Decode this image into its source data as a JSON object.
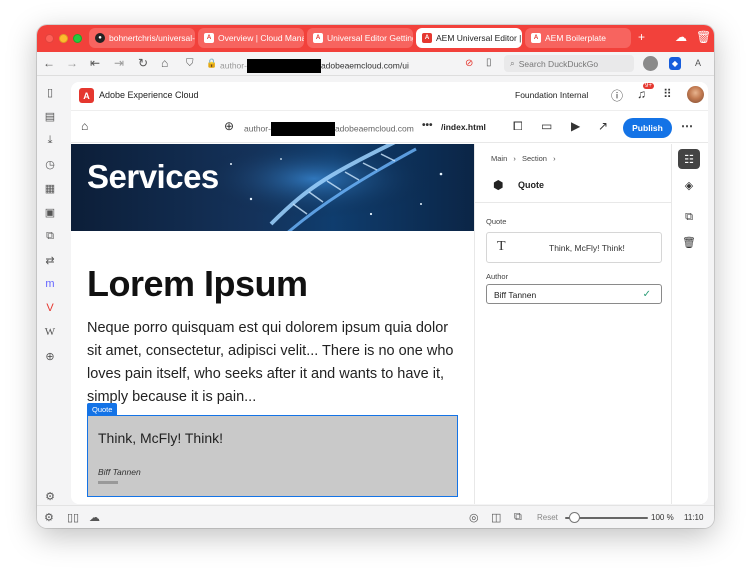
{
  "browser": {
    "tabs": [
      {
        "label": "bohnertchris/universal-",
        "icon": "github-icon"
      },
      {
        "label": "Overview | Cloud Manag",
        "icon": "adobe-icon"
      },
      {
        "label": "Universal Editor Getting",
        "icon": "adobe-icon"
      },
      {
        "label": "AEM Universal Editor | A",
        "icon": "adobe-icon",
        "active": true
      },
      {
        "label": "AEM Boilerplate",
        "icon": "adobe-icon"
      }
    ],
    "url_prefix": "author-",
    "url_suffix": "adobeaemcloud.com/ui",
    "search_placeholder": "Search DuckDuckGo"
  },
  "aec": {
    "logo_letter": "A",
    "title": "Adobe Experience Cloud",
    "org": "Foundation Internal",
    "notif_badge": "9+"
  },
  "ue_toolbar": {
    "url_prefix": "author-",
    "url_suffix": "adobeaemcloud.com",
    "more": "•••",
    "path": "/index.html",
    "publish_label": "Publish"
  },
  "preview": {
    "hero_title": "Services",
    "heading": "Lorem Ipsum",
    "paragraph": "Neque porro quisquam est qui dolorem ipsum quia dolor sit amet, consectetur, adipisci velit... There is no one who loves pain itself, who seeks after it and wants to have it, simply because it is pain...",
    "quote_tag": "Quote",
    "quote_text": "Think, McFly! Think!",
    "quote_author": "Biff Tannen"
  },
  "properties": {
    "breadcrumb": [
      "Main",
      "Section"
    ],
    "component_title": "Quote",
    "quote_label": "Quote",
    "quote_value": "Think, McFly! Think!",
    "author_label": "Author",
    "author_value": "Biff Tannen"
  },
  "statusbar": {
    "reset_label": "Reset",
    "zoom": "100 %",
    "time": "11:10",
    "zoom_level": 0.12
  },
  "colors": {
    "tabbar": "#f2413b",
    "adobe_red": "#e5372f",
    "accent_blue": "#1473e6"
  }
}
